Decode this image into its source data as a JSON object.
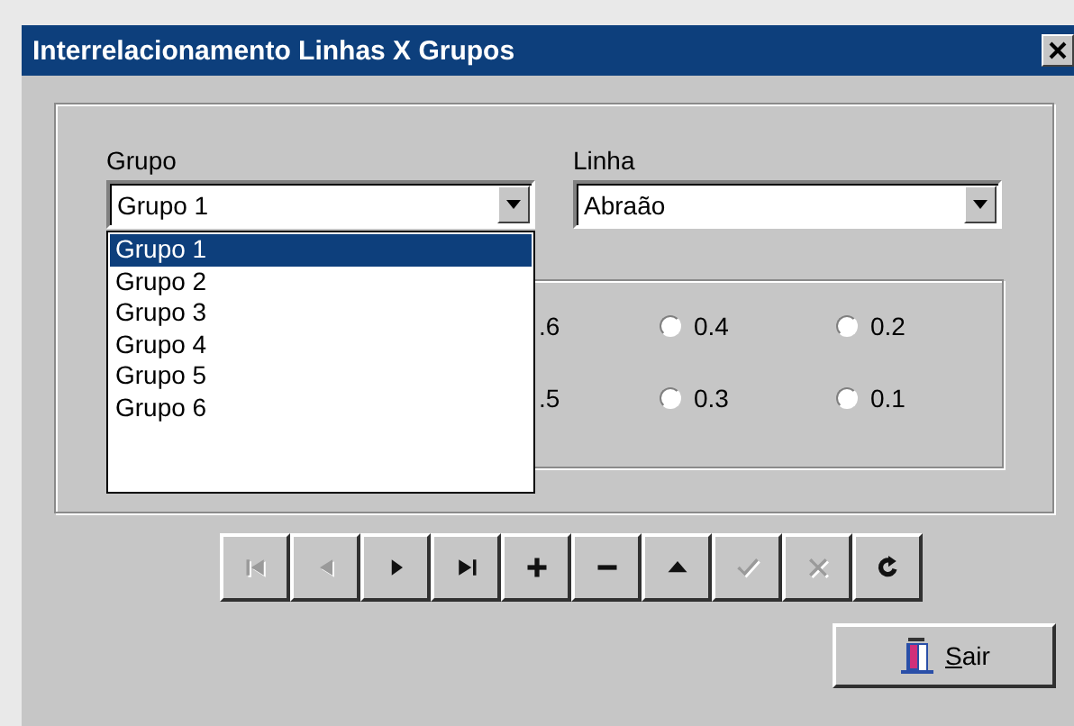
{
  "window": {
    "title": "Interrelacionamento Linhas X Grupos"
  },
  "grupo": {
    "label": "Grupo",
    "value": "Grupo 1",
    "expanded": true,
    "options": [
      {
        "label": "Grupo 1",
        "selected": true
      },
      {
        "label": "Grupo 2",
        "selected": false
      },
      {
        "label": "Grupo 3",
        "selected": false
      },
      {
        "label": "Grupo 4",
        "selected": false
      },
      {
        "label": "Grupo 5",
        "selected": false
      },
      {
        "label": "Grupo 6",
        "selected": false
      }
    ]
  },
  "linha": {
    "label": "Linha",
    "value": "Abraão"
  },
  "radios": [
    {
      "kind": "cut",
      "label": ".6"
    },
    {
      "kind": "radio",
      "label": "0.4",
      "checked": false
    },
    {
      "kind": "radio",
      "label": "0.2",
      "checked": false
    },
    {
      "kind": "cut",
      "label": ".5"
    },
    {
      "kind": "radio",
      "label": "0.3",
      "checked": false
    },
    {
      "kind": "radio",
      "label": "0.1",
      "checked": false
    }
  ],
  "toolbar": [
    {
      "kind": "first",
      "disabled": true
    },
    {
      "kind": "prev",
      "disabled": true
    },
    {
      "kind": "next",
      "disabled": false
    },
    {
      "kind": "last",
      "disabled": false
    },
    {
      "kind": "add",
      "disabled": false
    },
    {
      "kind": "remove",
      "disabled": false
    },
    {
      "kind": "up",
      "disabled": false
    },
    {
      "kind": "confirm",
      "disabled": true
    },
    {
      "kind": "cancel",
      "disabled": true
    },
    {
      "kind": "refresh",
      "disabled": false
    }
  ],
  "exit_button": {
    "label": "Sair",
    "mnemonic": true
  }
}
